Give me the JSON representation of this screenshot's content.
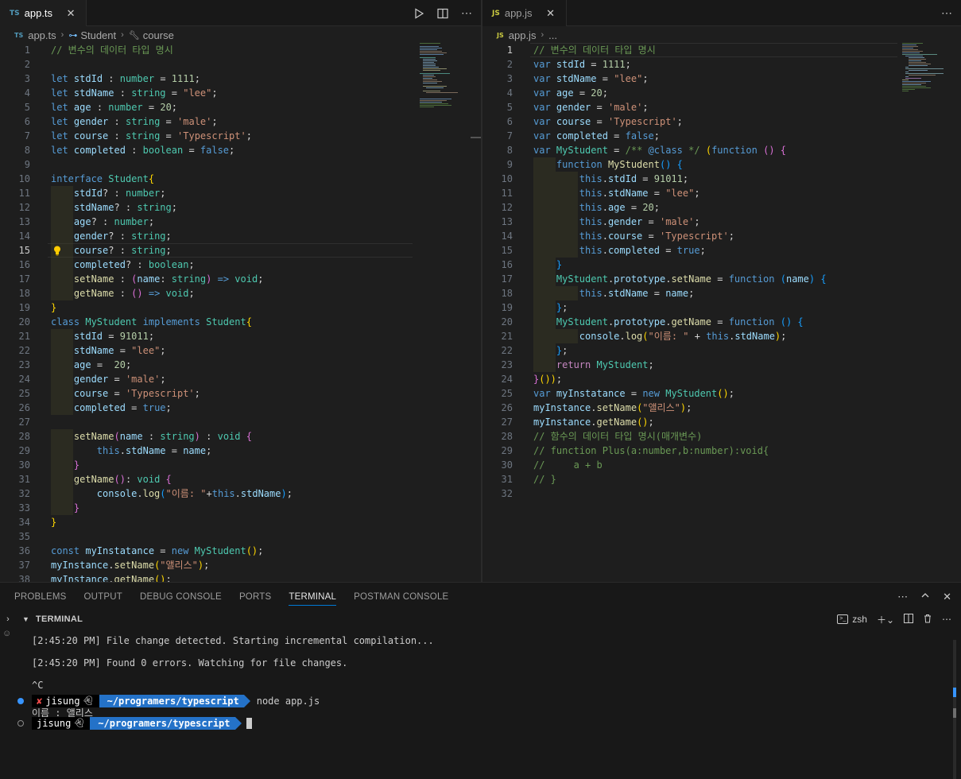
{
  "left_editor": {
    "tab": {
      "type": "TS",
      "name": "app.ts",
      "close": "✕"
    },
    "breadcrumb": {
      "file_type": "TS",
      "file": "app.ts",
      "symbol1": "Student",
      "symbol2": "course"
    },
    "current_line": 15
  },
  "right_editor": {
    "tab": {
      "type": "JS",
      "name": "app.js",
      "close": "✕"
    },
    "breadcrumb": {
      "file_type": "JS",
      "file": "app.js",
      "rest": "..."
    },
    "current_line": 1
  },
  "panel": {
    "tabs": [
      "PROBLEMS",
      "OUTPUT",
      "DEBUG CONSOLE",
      "PORTS",
      "TERMINAL",
      "POSTMAN CONSOLE"
    ],
    "active_tab": "TERMINAL",
    "terminal_title": "TERMINAL",
    "shell": "zsh"
  },
  "terminal": {
    "line1": "[2:45:20 PM] File change detected. Starting incremental compilation...",
    "line2": "[2:45:20 PM] Found 0 errors. Watching for file changes.",
    "line3": "^C",
    "user": "jisung",
    "path": "~/programers/typescript",
    "command": "node app.js",
    "output": "이름 : 앨리스"
  },
  "colors": {
    "accent": "#0078d4",
    "prompt_path": "#2472c8",
    "error_x": "#f14c4c"
  }
}
